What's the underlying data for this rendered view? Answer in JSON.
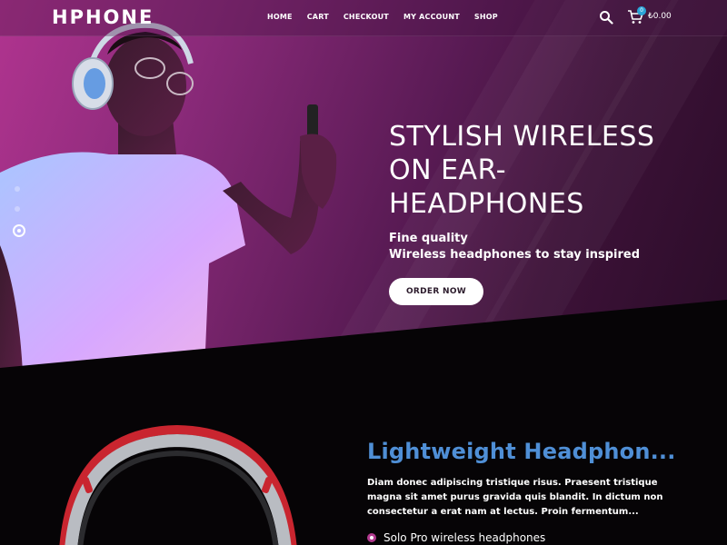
{
  "header": {
    "logo": "HPHONE",
    "nav": [
      "HOME",
      "CART",
      "CHECKOUT",
      "MY ACCOUNT",
      "SHOP"
    ],
    "cart_count": "0",
    "cart_total": "₺0.00"
  },
  "hero": {
    "title_line1": "STYLISH WIRELESS",
    "title_line2": "ON EAR-",
    "title_line3": "HEADPHONES",
    "subtitle1": "Fine quality",
    "subtitle2": "Wireless headphones to stay inspired",
    "button_label": "ORDER NOW",
    "slider_dots": 3,
    "active_slide": 3
  },
  "feature": {
    "title": "Lightweight Headphon...",
    "description": "Diam donec adipiscing tristique risus. Praesent tristique magna sit amet purus gravida quis blandit. In dictum non consectetur a erat nam at lectus. Proin fermentum...",
    "items": [
      "Solo Pro wireless headphones"
    ]
  },
  "colors": {
    "accent_blue": "#4f8fd6",
    "accent_magenta": "#b23a8f",
    "badge": "#2aa4d8"
  },
  "icons": [
    "search-icon",
    "cart-icon",
    "bullet-icon"
  ]
}
